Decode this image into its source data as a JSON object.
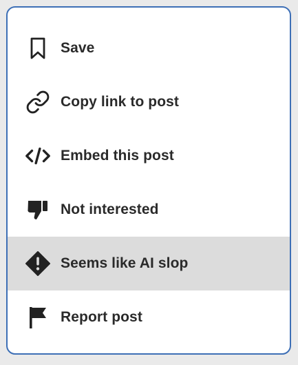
{
  "menu": {
    "items": [
      {
        "label": "Save",
        "icon": "bookmark-icon",
        "highlighted": false
      },
      {
        "label": "Copy link to post",
        "icon": "link-icon",
        "highlighted": false
      },
      {
        "label": "Embed this post",
        "icon": "code-icon",
        "highlighted": false
      },
      {
        "label": "Not interested",
        "icon": "thumbs-down-icon",
        "highlighted": false
      },
      {
        "label": "Seems like AI slop",
        "icon": "warning-diamond-icon",
        "highlighted": true
      },
      {
        "label": "Report post",
        "icon": "flag-icon",
        "highlighted": false
      }
    ]
  },
  "colors": {
    "border": "#3d6fb6",
    "highlight_bg": "#dcdcdc",
    "text": "#2a2a2a",
    "icon": "#222222"
  }
}
